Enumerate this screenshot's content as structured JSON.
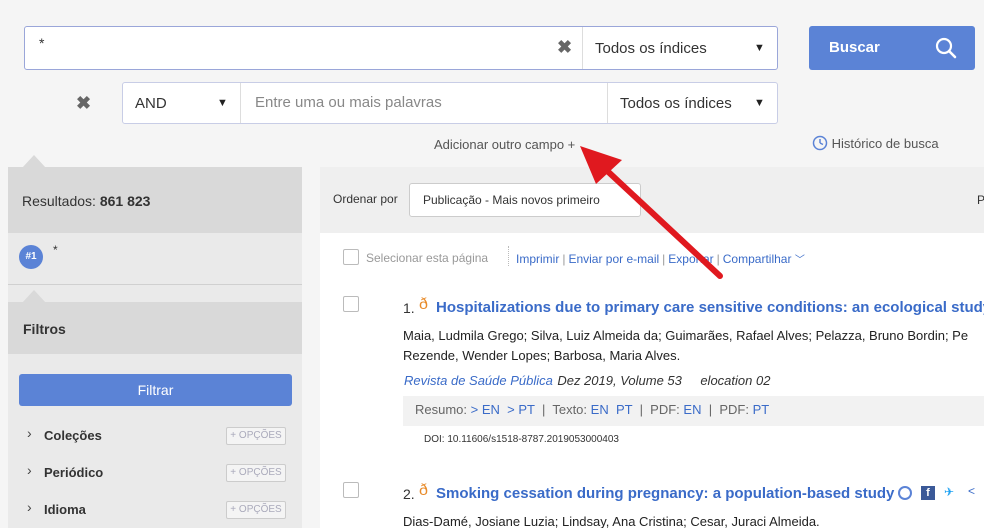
{
  "search": {
    "query": "*",
    "index_select": "Todos os índices",
    "button_label": "Buscar"
  },
  "row2": {
    "operator": "AND",
    "placeholder": "Entre uma ou mais palavras",
    "index_select": "Todos os índices"
  },
  "links": {
    "add_field": "Adicionar outro campo +",
    "history": "Histórico de busca"
  },
  "sidebar": {
    "results_label": "Resultados:",
    "results_count": "861 823",
    "query_badge": "#1",
    "query_text": "*",
    "filters_title": "Filtros",
    "filter_button": "Filtrar",
    "facets": [
      {
        "label": "Coleções",
        "options": "+ OPÇÕES"
      },
      {
        "label": "Periódico",
        "options": "+ OPÇÕES"
      },
      {
        "label": "Idioma",
        "options": "+ OPÇÕES"
      }
    ]
  },
  "sort": {
    "label": "Ordenar por",
    "value": "Publicação - Mais novos primeiro",
    "extra": "P"
  },
  "toolbar": {
    "select_page": "Selecionar esta página",
    "print": "Imprimir",
    "email": "Enviar por e-mail",
    "export": "Exportar",
    "share": "Compartilhar"
  },
  "results": [
    {
      "number": "1.",
      "title": "Hospitalizations due to primary care sensitive conditions: an ecological study",
      "authors_line1": "Maia, Ludmila Grego; Silva, Luiz Almeida da; Guimarães, Rafael Alves; Pelazza, Bruno Bordin; Pe",
      "authors_line2": "Rezende, Wender Lopes; Barbosa, Maria Alves.",
      "journal": "Revista de Saúde Pública",
      "date_volume": "Dez 2019, Volume 53",
      "elocation": "elocation 02",
      "resumo_label": "Resumo:",
      "resumo_en": "> EN",
      "resumo_pt": "> PT",
      "texto_label": "Texto:",
      "texto_en": "EN",
      "texto_pt": "PT",
      "pdf1_label": "PDF:",
      "pdf1": "EN",
      "pdf2_label": "PDF:",
      "pdf2": "PT",
      "doi": "DOI: 10.11606/s1518-8787.2019053000403"
    },
    {
      "number": "2.",
      "title": "Smoking cessation during pregnancy: a population-based study",
      "authors_line1": "Dias-Damé, Josiane Luzia; Lindsay, Ana Cristina; Cesar, Juraci Almeida."
    }
  ]
}
